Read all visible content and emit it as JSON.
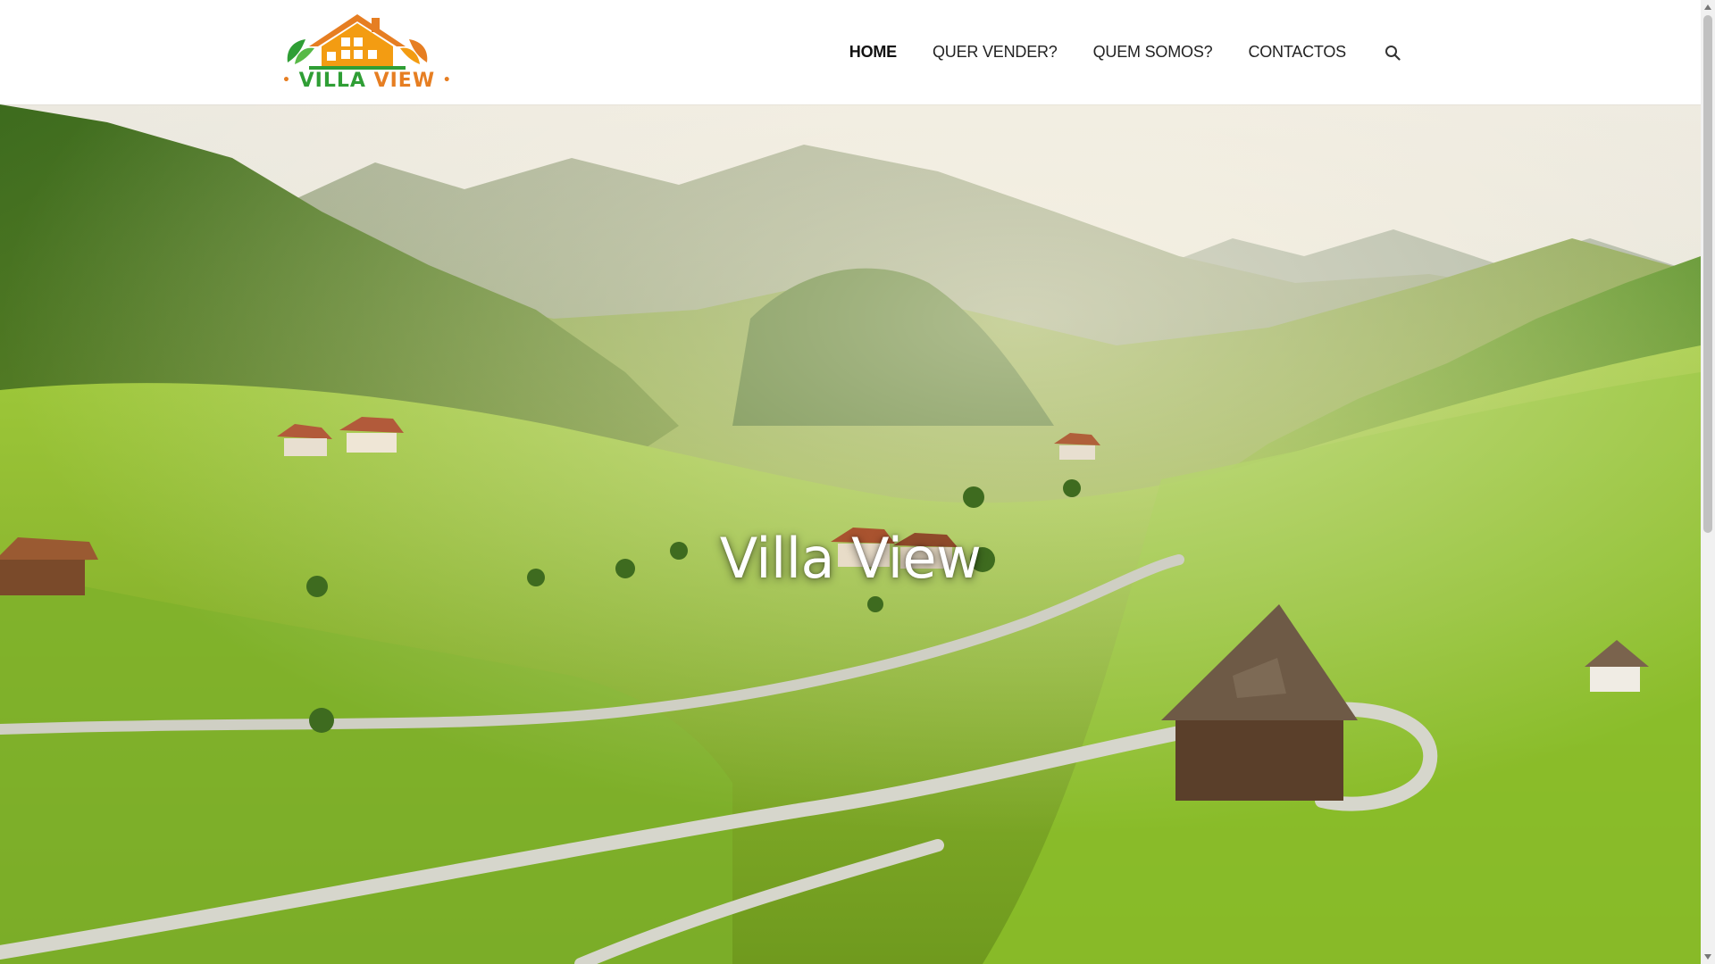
{
  "brand": {
    "logo_text_1": "VILLA",
    "logo_text_2": "VIEW",
    "logo_bullet": "•",
    "colors": {
      "green": "#2f9e35",
      "orange": "#e67e22"
    }
  },
  "nav": {
    "items": [
      {
        "label": "HOME",
        "active": true
      },
      {
        "label": "QUER VENDER?",
        "active": false
      },
      {
        "label": "QUEM SOMOS?",
        "active": false
      },
      {
        "label": "CONTACTOS",
        "active": false
      }
    ],
    "search_icon": "search-icon"
  },
  "hero": {
    "title": "Villa View",
    "background": "mountain-valley-landscape"
  },
  "scrollbar": {
    "up_icon": "arrow-up-icon",
    "down_icon": "arrow-down-icon"
  }
}
